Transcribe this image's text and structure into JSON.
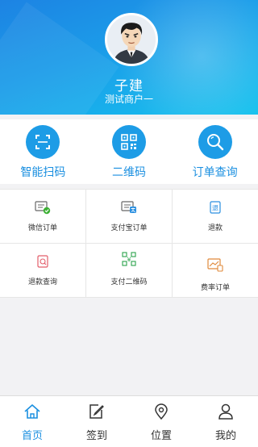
{
  "profile": {
    "name": "子建",
    "merchant": "测试商户一",
    "avatar_icon": "user-avatar"
  },
  "quick_actions": [
    {
      "label": "智能扫码",
      "icon": "scan-icon"
    },
    {
      "label": "二维码",
      "icon": "qrcode-icon"
    },
    {
      "label": "订单查询",
      "icon": "search-icon"
    }
  ],
  "grid_items": [
    {
      "label": "微信订单",
      "icon": "wechat-order-icon"
    },
    {
      "label": "支付宝订单",
      "icon": "alipay-order-icon"
    },
    {
      "label": "退款",
      "icon": "refund-icon",
      "icon_text": "退"
    },
    {
      "label": "退款查询",
      "icon": "refund-query-icon"
    },
    {
      "label": "支付二维码",
      "icon": "pay-qrcode-icon",
      "icon_text": "¥"
    },
    {
      "label": "费率订单",
      "icon": "rate-order-icon"
    }
  ],
  "tabs": [
    {
      "label": "首页",
      "icon": "home-icon",
      "active": true
    },
    {
      "label": "签到",
      "icon": "checkin-icon",
      "active": false
    },
    {
      "label": "位置",
      "icon": "location-icon",
      "active": false
    },
    {
      "label": "我的",
      "icon": "profile-icon",
      "active": false
    }
  ],
  "colors": {
    "primary": "#1d9ce6",
    "header_start": "#1d83e3",
    "header_end": "#15c2ee",
    "wechat_green": "#3cb034",
    "alipay_blue": "#2a8fe0",
    "refund_red": "#e35d6a",
    "qrcode_green": "#2aa24b",
    "rate_orange": "#e0893a"
  }
}
